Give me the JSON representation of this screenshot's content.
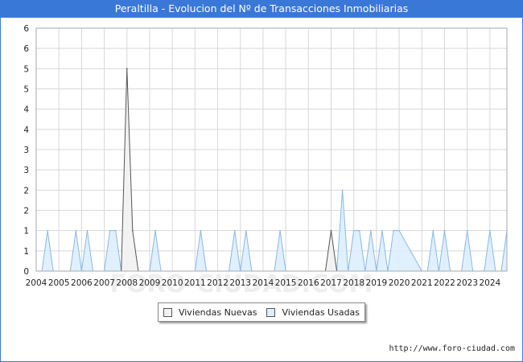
{
  "title": "Peraltilla - Evolucion del Nº de Transacciones Inmobiliarias",
  "source_url": "http://www.foro-ciudad.com",
  "watermark": "FORO-CIUDAD.COM",
  "colors": {
    "title_bar": "#3a78d8",
    "nuevas_fill": "#f2f2f2",
    "nuevas_line": "#555555",
    "usadas_fill": "#ddeeff",
    "usadas_line": "#8ab8e8",
    "grid": "#d8d8d8"
  },
  "chart_data": {
    "type": "area",
    "title": "Peraltilla - Evolucion del Nº de Transacciones Inmobiliarias",
    "xlabel": "",
    "ylabel": "",
    "xlim": [
      2004,
      2024.75
    ],
    "ylim": [
      0,
      6
    ],
    "x_ticks": [
      "2004",
      "2005",
      "2006",
      "2007",
      "2008",
      "2009",
      "2010",
      "2011",
      "2012",
      "2013",
      "2014",
      "2015",
      "2016",
      "2017",
      "2018",
      "2019",
      "2020",
      "2021",
      "2022",
      "2023",
      "2024"
    ],
    "y_ticks": [
      "0",
      "1",
      "1",
      "2",
      "2",
      "3",
      "3",
      "4",
      "4",
      "5",
      "5",
      "6"
    ],
    "grid": true,
    "legend_position": "bottom",
    "series": [
      {
        "name": "Viviendas Nuevas",
        "x": [
          2007.75,
          2008.0,
          2008.25,
          2008.5,
          2016.75,
          2017.0,
          2017.25
        ],
        "y": [
          0,
          5,
          1,
          0,
          0,
          1,
          0
        ]
      },
      {
        "name": "Viviendas Usadas",
        "x": [
          2004.25,
          2004.5,
          2004.75,
          2005.5,
          2005.75,
          2006.0,
          2006.25,
          2006.5,
          2007.0,
          2007.25,
          2007.5,
          2007.75,
          2008.0,
          2008.5,
          2009.0,
          2009.25,
          2009.5,
          2011.0,
          2011.25,
          2011.5,
          2012.5,
          2012.75,
          2013.0,
          2013.25,
          2013.5,
          2014.5,
          2014.75,
          2015.0,
          2017.25,
          2017.5,
          2017.75,
          2018.0,
          2018.25,
          2018.5,
          2018.75,
          2019.0,
          2019.25,
          2019.5,
          2019.75,
          2020.0,
          2021.0,
          2021.25,
          2021.5,
          2021.75,
          2022.0,
          2022.25,
          2022.75,
          2023.0,
          2023.25,
          2023.75,
          2024.0,
          2024.25,
          2024.5,
          2024.75
        ],
        "y": [
          0,
          1,
          0,
          0,
          1,
          0,
          1,
          0,
          0,
          1,
          1,
          0,
          0,
          0,
          0,
          1,
          0,
          0,
          1,
          0,
          0,
          1,
          0,
          1,
          0,
          0,
          1,
          0,
          0,
          2,
          0,
          1,
          1,
          0,
          1,
          0,
          1,
          0,
          1,
          1,
          0,
          0,
          1,
          0,
          1,
          0,
          0,
          1,
          0,
          0,
          1,
          0,
          0,
          1
        ]
      }
    ]
  },
  "legend": [
    {
      "label": "Viviendas Nuevas"
    },
    {
      "label": "Viviendas Usadas"
    }
  ]
}
